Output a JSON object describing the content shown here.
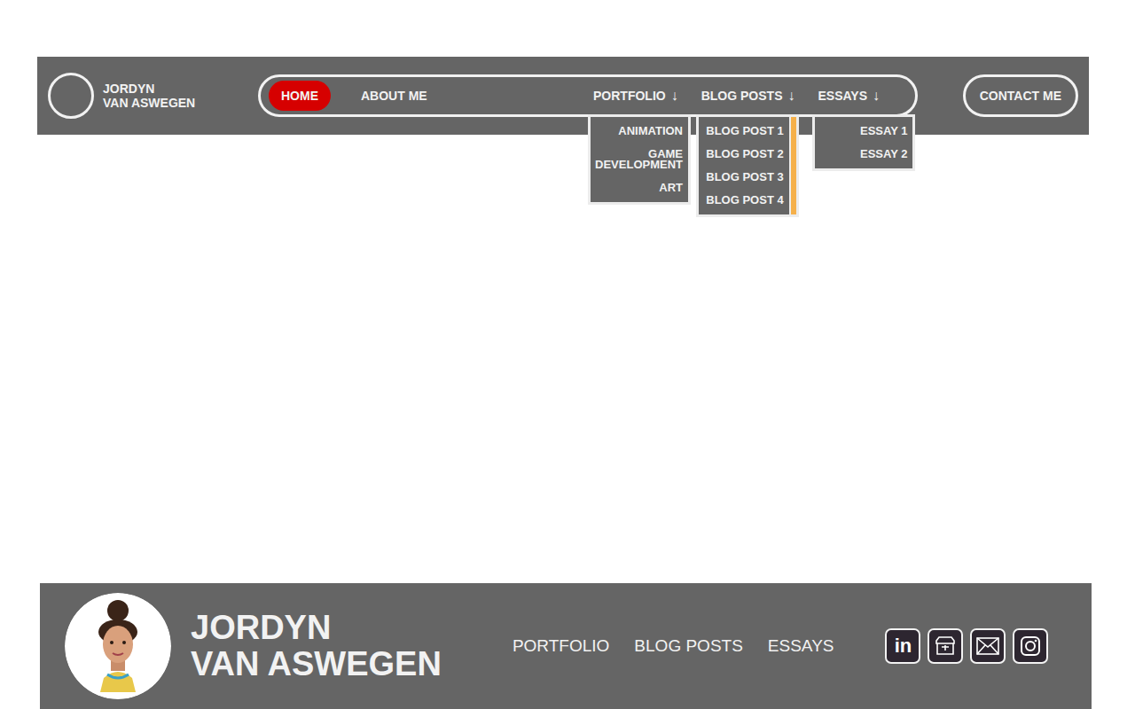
{
  "header": {
    "logo_name": [
      "JORDYN",
      "VAN ASWEGEN"
    ],
    "nav": [
      {
        "label": "HOME",
        "selected": true,
        "arrow": "",
        "expanded": false,
        "scrollable": false,
        "items": []
      },
      {
        "label": "ABOUT ME",
        "selected": false,
        "arrow": "",
        "expanded": false,
        "scrollable": false,
        "items": []
      },
      {
        "label": "PORTFOLIO",
        "selected": false,
        "arrow": "↓",
        "expanded": true,
        "scrollable": false,
        "items": [
          "ANIMATION",
          "GAME DEVELOPMENT",
          "ART"
        ]
      },
      {
        "label": "BLOG POSTS",
        "selected": false,
        "arrow": "↓",
        "expanded": true,
        "scrollable": true,
        "items": [
          "BLOG POST 1",
          "BLOG POST 2",
          "BLOG POST 3",
          "BLOG POST 4"
        ]
      },
      {
        "label": "ESSAYS",
        "selected": false,
        "arrow": "↓",
        "expanded": true,
        "scrollable": false,
        "items": [
          "ESSAY 1",
          "ESSAY 2"
        ]
      }
    ],
    "contact_button": "CONTACT ME"
  },
  "footer": {
    "name": [
      "JORDYN",
      "VAN ASWEGEN"
    ],
    "links": [
      "PORTFOLIO",
      "BLOG POSTS",
      "ESSAYS"
    ],
    "social": [
      {
        "kind": "linkedin",
        "glyph": "in"
      },
      {
        "kind": "itch",
        "glyph": ""
      },
      {
        "kind": "mail",
        "glyph": ""
      },
      {
        "kind": "instagram",
        "glyph": ""
      }
    ]
  }
}
